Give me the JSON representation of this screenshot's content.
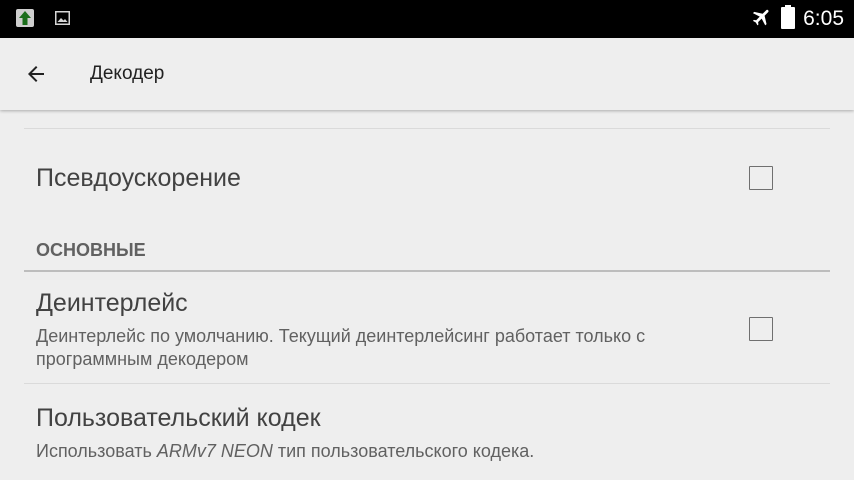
{
  "status_bar": {
    "time": "6:05",
    "icons": [
      "upload-icon",
      "image-icon",
      "airplane-mode-icon",
      "battery-icon"
    ]
  },
  "toolbar": {
    "back_icon": "arrow-back-icon",
    "title": "Декодер"
  },
  "preferences": {
    "pseudo_accel": {
      "title": "Псевдоускорение",
      "checked": false
    },
    "category": {
      "title": "ОСНОВНЫЕ"
    },
    "deinterlace": {
      "title": "Деинтерлейс",
      "summary": "Деинтерлейс по умолчанию. Текущий деинтерлейсинг работает только с программным декодером",
      "checked": false
    },
    "custom_codec": {
      "title": "Пользовательский кодек",
      "summary_before": "Использовать ",
      "summary_em": "ARMv7 NEON",
      "summary_after": " тип пользовательского кодека."
    }
  },
  "colors": {
    "status_bar": "#000000",
    "background": "#eeeeee",
    "title_text": "#424242",
    "summary_text": "#616161",
    "divider": "#dadada"
  }
}
